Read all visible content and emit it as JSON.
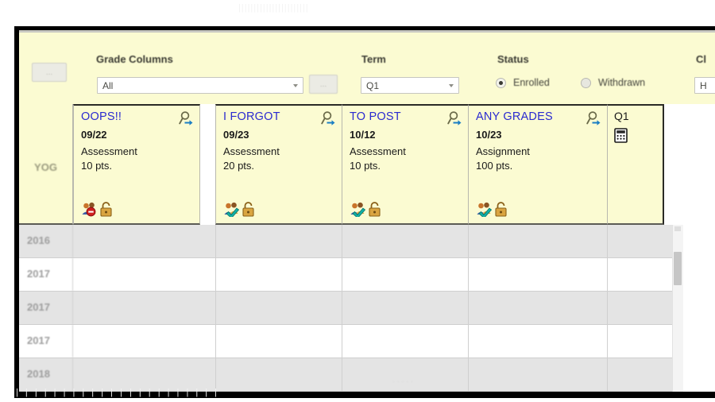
{
  "toolbar": {
    "left_button_label": "...",
    "grade_columns": {
      "label": "Grade Columns",
      "value": "All",
      "refresh_button_label": "..."
    },
    "term": {
      "label": "Term",
      "value": "Q1"
    },
    "status": {
      "label": "Status",
      "enrolled_label": "Enrolled",
      "withdrawn_label": "Withdrawn",
      "selected": "Enrolled"
    },
    "class_section": {
      "label": "Cl",
      "value": "H"
    }
  },
  "grid": {
    "yog_header": "YOG",
    "columns": [
      {
        "title": "OOPS!!",
        "date": "09/22",
        "type": "Assessment",
        "points": "10 pts.",
        "post_status": "not-posted",
        "lock": "unlocked",
        "search_icon": "magnifier-arrow-icon"
      },
      {
        "title": "I FORGOT",
        "date": "09/23",
        "type": "Assessment",
        "points": "20 pts.",
        "post_status": "posted",
        "lock": "unlocked",
        "search_icon": "magnifier-arrow-icon"
      },
      {
        "title": "TO POST",
        "date": "10/12",
        "type": "Assessment",
        "points": "10 pts.",
        "post_status": "posted",
        "lock": "unlocked",
        "search_icon": "magnifier-arrow-icon"
      },
      {
        "title": "ANY GRADES",
        "date": "10/23",
        "type": "Assignment",
        "points": "100 pts.",
        "post_status": "posted",
        "lock": "unlocked",
        "search_icon": "magnifier-arrow-icon"
      }
    ],
    "computed_column": {
      "title": "Q1",
      "icon": "calculator-icon"
    },
    "rows": [
      {
        "yog": "2016",
        "cells": [
          "",
          "",
          "",
          "",
          ""
        ]
      },
      {
        "yog": "2017",
        "cells": [
          "",
          "",
          "",
          "",
          ""
        ]
      },
      {
        "yog": "2017",
        "cells": [
          "",
          "",
          "",
          "",
          ""
        ]
      },
      {
        "yog": "2017",
        "cells": [
          "",
          "",
          "",
          "",
          ""
        ]
      },
      {
        "yog": "2018",
        "cells": [
          "",
          "",
          "",
          "",
          ""
        ]
      }
    ]
  },
  "colors": {
    "header_bg": "#fbfbd2",
    "link_blue": "#2a2ad0",
    "row_alt": "#e4e4e4",
    "frame": "#000000"
  }
}
